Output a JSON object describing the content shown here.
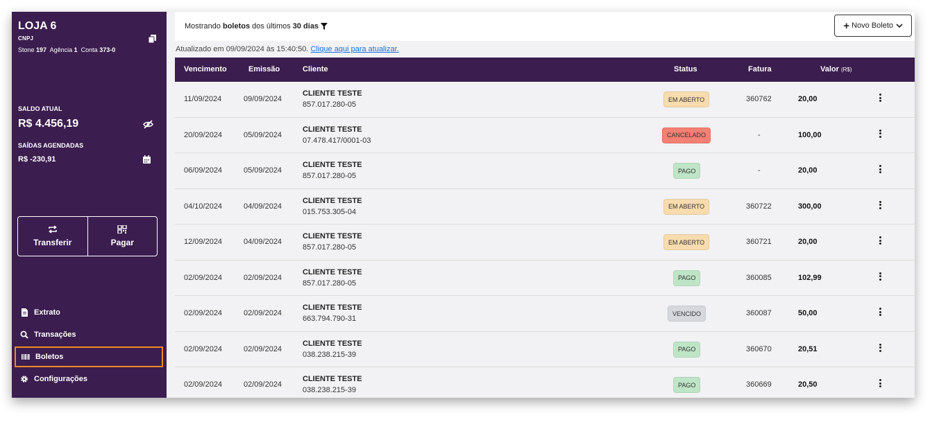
{
  "store": {
    "name": "LOJA 6",
    "cnpj_label": "CNPJ",
    "bank_label": "Stone",
    "bank_code": "197",
    "agency_label": "Agência",
    "agency": "1",
    "account_label": "Conta",
    "account": "373-0"
  },
  "balance": {
    "label": "SALDO ATUAL",
    "value": "R$ 4.456,19",
    "scheduled_label": "SAÍDAS AGENDADAS",
    "scheduled_value": "R$ -230,91"
  },
  "actions": {
    "transfer": "Transferir",
    "pay": "Pagar"
  },
  "nav": {
    "items": [
      {
        "label": "Extrato",
        "icon": "document-icon"
      },
      {
        "label": "Transações",
        "icon": "search-icon"
      },
      {
        "label": "Boletos",
        "icon": "barcode-icon"
      },
      {
        "label": "Configurações",
        "icon": "gear-icon"
      }
    ],
    "active": "Boletos",
    "active_color": "#f28a24"
  },
  "header": {
    "showing_prefix": "Mostrando",
    "showing_bold1": "boletos",
    "showing_mid": "dos últimos",
    "showing_bold2": "30 dias",
    "new_button": "Novo Boleto"
  },
  "updated": {
    "text": "Atualizado em 09/09/2024 às 15:40:50.",
    "link": "Clique aqui para atualizar."
  },
  "table": {
    "columns": {
      "due": "Vencimento",
      "issued": "Emissão",
      "client": "Cliente",
      "status": "Status",
      "invoice": "Fatura",
      "value": "Valor",
      "value_unit": "(R$)"
    },
    "rows": [
      {
        "due": "11/09/2024",
        "issued": "09/09/2024",
        "client": "CLIENTE TESTE",
        "doc": "857.017.280-05",
        "status": "EM ABERTO",
        "invoice": "360762",
        "value": "20,00"
      },
      {
        "due": "20/09/2024",
        "issued": "05/09/2024",
        "client": "CLIENTE TESTE",
        "doc": "07.478.417/0001-03",
        "status": "CANCELADO",
        "invoice": "-",
        "value": "100,00"
      },
      {
        "due": "06/09/2024",
        "issued": "05/09/2024",
        "client": "CLIENTE TESTE",
        "doc": "857.017.280-05",
        "status": "PAGO",
        "invoice": "-",
        "value": "20,00"
      },
      {
        "due": "04/10/2024",
        "issued": "04/09/2024",
        "client": "CLIENTE TESTE",
        "doc": "015.753.305-04",
        "status": "EM ABERTO",
        "invoice": "360722",
        "value": "300,00"
      },
      {
        "due": "12/09/2024",
        "issued": "04/09/2024",
        "client": "CLIENTE TESTE",
        "doc": "857.017.280-05",
        "status": "EM ABERTO",
        "invoice": "360721",
        "value": "20,00"
      },
      {
        "due": "02/09/2024",
        "issued": "02/09/2024",
        "client": "CLIENTE TESTE",
        "doc": "857.017.280-05",
        "status": "PAGO",
        "invoice": "360085",
        "value": "102,99"
      },
      {
        "due": "02/09/2024",
        "issued": "02/09/2024",
        "client": "CLIENTE TESTE",
        "doc": "663.794.790-31",
        "status": "VENCIDO",
        "invoice": "360087",
        "value": "50,00"
      },
      {
        "due": "02/09/2024",
        "issued": "02/09/2024",
        "client": "CLIENTE TESTE",
        "doc": "038.238.215-39",
        "status": "PAGO",
        "invoice": "360670",
        "value": "20,51"
      },
      {
        "due": "02/09/2024",
        "issued": "02/09/2024",
        "client": "CLIENTE TESTE",
        "doc": "038.238.215-39",
        "status": "PAGO",
        "invoice": "360669",
        "value": "20,50"
      }
    ]
  },
  "status_colors": {
    "EM ABERTO": "#f8dcae",
    "CANCELADO": "#f47f73",
    "PAGO": "#bfe5c7",
    "VENCIDO": "#d6d8de"
  },
  "colors": {
    "sidebar": "#3b1d4f",
    "header_row": "#3b1d4f",
    "link": "#1a6fd6"
  }
}
